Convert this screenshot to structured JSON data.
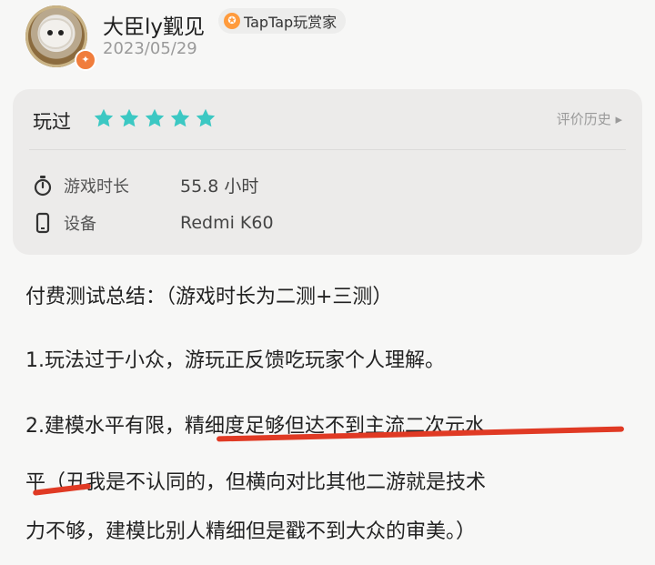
{
  "user": {
    "name": "大臣ly觐见",
    "badge": "TapTap玩赏家",
    "date": "2023/05/29"
  },
  "card": {
    "status": "玩过",
    "rating": 5,
    "rating_max": 5,
    "star_color": "#3cc8c3",
    "history_label": "评价历史 ▸",
    "rows": [
      {
        "icon": "stopwatch-icon",
        "label": "游戏时长",
        "value": "55.8 小时"
      },
      {
        "icon": "phone-icon",
        "label": "设备",
        "value": "Redmi K60"
      }
    ]
  },
  "review": {
    "line1": "付费测试总结：（游戏时长为二测+三测）",
    "line2": "1.玩法过于小众，游玩正反馈吃玩家个人理解。",
    "line3_a": "2.建模水平有限，",
    "line3_b": "精细度足够但达不到主流二次元水",
    "line4_a": "平",
    "line4_b": "（丑我是不认同的，但横向对比其他二游就是技术",
    "line5": "力不够，建模比别人精细但是戳不到大众的审美。）"
  },
  "annotation_color": "#e03a24"
}
